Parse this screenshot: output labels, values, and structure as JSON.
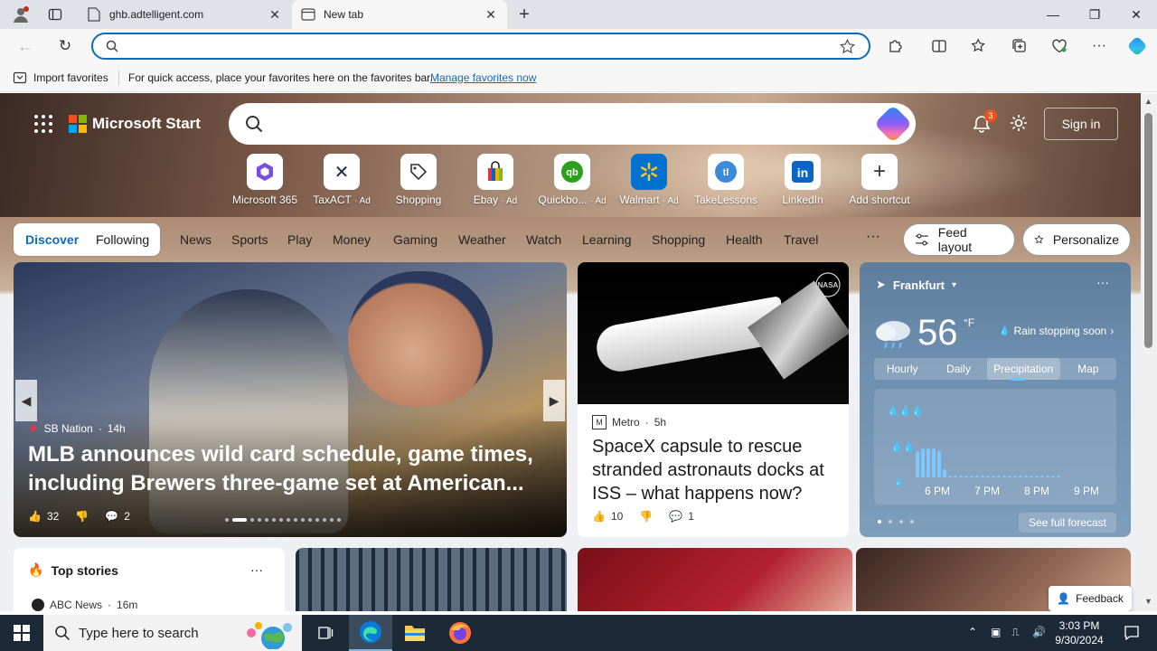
{
  "browser": {
    "tabs": [
      {
        "title": "ghb.adtelligent.com",
        "active": false
      },
      {
        "title": "New tab",
        "active": true
      }
    ],
    "address_value": "",
    "address_placeholder": ""
  },
  "favorites_bar": {
    "import_label": "Import favorites",
    "hint": "For quick access, place your favorites here on the favorites bar.",
    "manage_link": "Manage favorites now"
  },
  "header": {
    "brand": "Microsoft Start",
    "search_placeholder": "",
    "notification_count": "3",
    "signin_label": "Sign in"
  },
  "shortcuts": [
    {
      "label": "Microsoft 365",
      "ad": "",
      "icon": "microsoft-365-icon",
      "color": "#7b4de0"
    },
    {
      "label": "TaxACT",
      "ad": "· Ad",
      "icon": "taxact-icon",
      "color": "#1c2a4a"
    },
    {
      "label": "Shopping",
      "ad": "",
      "icon": "tag-icon",
      "color": "#333333"
    },
    {
      "label": "Ebay",
      "ad": "· Ad",
      "icon": "ebay-bag-icon",
      "color": "#e53238"
    },
    {
      "label": "Quickbo...",
      "ad": "· Ad",
      "icon": "quickbooks-icon",
      "color": "#2ca01c"
    },
    {
      "label": "Walmart",
      "ad": "· Ad",
      "icon": "walmart-icon",
      "color": "#0071ce"
    },
    {
      "label": "TakeLessons",
      "ad": "",
      "icon": "takelessons-icon",
      "color": "#3d8ad9"
    },
    {
      "label": "LinkedIn",
      "ad": "",
      "icon": "linkedin-icon",
      "color": "#0a66c2"
    },
    {
      "label": "Add shortcut",
      "ad": "",
      "icon": "plus-icon",
      "color": "#333333"
    }
  ],
  "nav": {
    "discover": "Discover",
    "following": "Following",
    "items": [
      "News",
      "Sports",
      "Play",
      "Money",
      "Gaming",
      "Weather",
      "Watch",
      "Learning",
      "Shopping",
      "Health",
      "Travel"
    ],
    "more": "···",
    "feed_layout": "Feed layout",
    "personalize": "Personalize"
  },
  "hero_story": {
    "source": "SB Nation",
    "age": "14h",
    "title": "MLB announces wild card schedule, game times, including Brewers three-game set at American...",
    "likes": "32",
    "comments": "2",
    "slide_count": 15,
    "active_slide": 1
  },
  "news_story": {
    "source": "Metro",
    "age": "5h",
    "title": "SpaceX capsule to rescue stranded astronauts docks at ISS – what happens now?",
    "likes": "10",
    "comments": "1"
  },
  "weather": {
    "location": "Frankfurt",
    "temperature": "56",
    "unit": "°F",
    "condition": "Rain stopping soon",
    "tabs": [
      "Hourly",
      "Daily",
      "Precipitation",
      "Map"
    ],
    "selected_tab": "Precipitation",
    "times": [
      "6 PM",
      "7 PM",
      "8 PM",
      "9 PM"
    ],
    "precip_levels": [
      0.8,
      0.9,
      0.9,
      0.9,
      0.8,
      0.25,
      0.05,
      0.05,
      0.05,
      0.05,
      0.05,
      0.05,
      0.05,
      0.05,
      0.05,
      0.05,
      0.05,
      0.05,
      0.05,
      0.05,
      0.05,
      0.05,
      0.05,
      0.05,
      0.05,
      0.05,
      0.05
    ],
    "full_forecast": "See full forecast"
  },
  "top_stories": {
    "title": "Top stories",
    "source": "ABC News",
    "age": "16m"
  },
  "feedback_label": "Feedback",
  "taskbar": {
    "search_placeholder": "Type here to search",
    "time": "3:03 PM",
    "date": "9/30/2024"
  }
}
